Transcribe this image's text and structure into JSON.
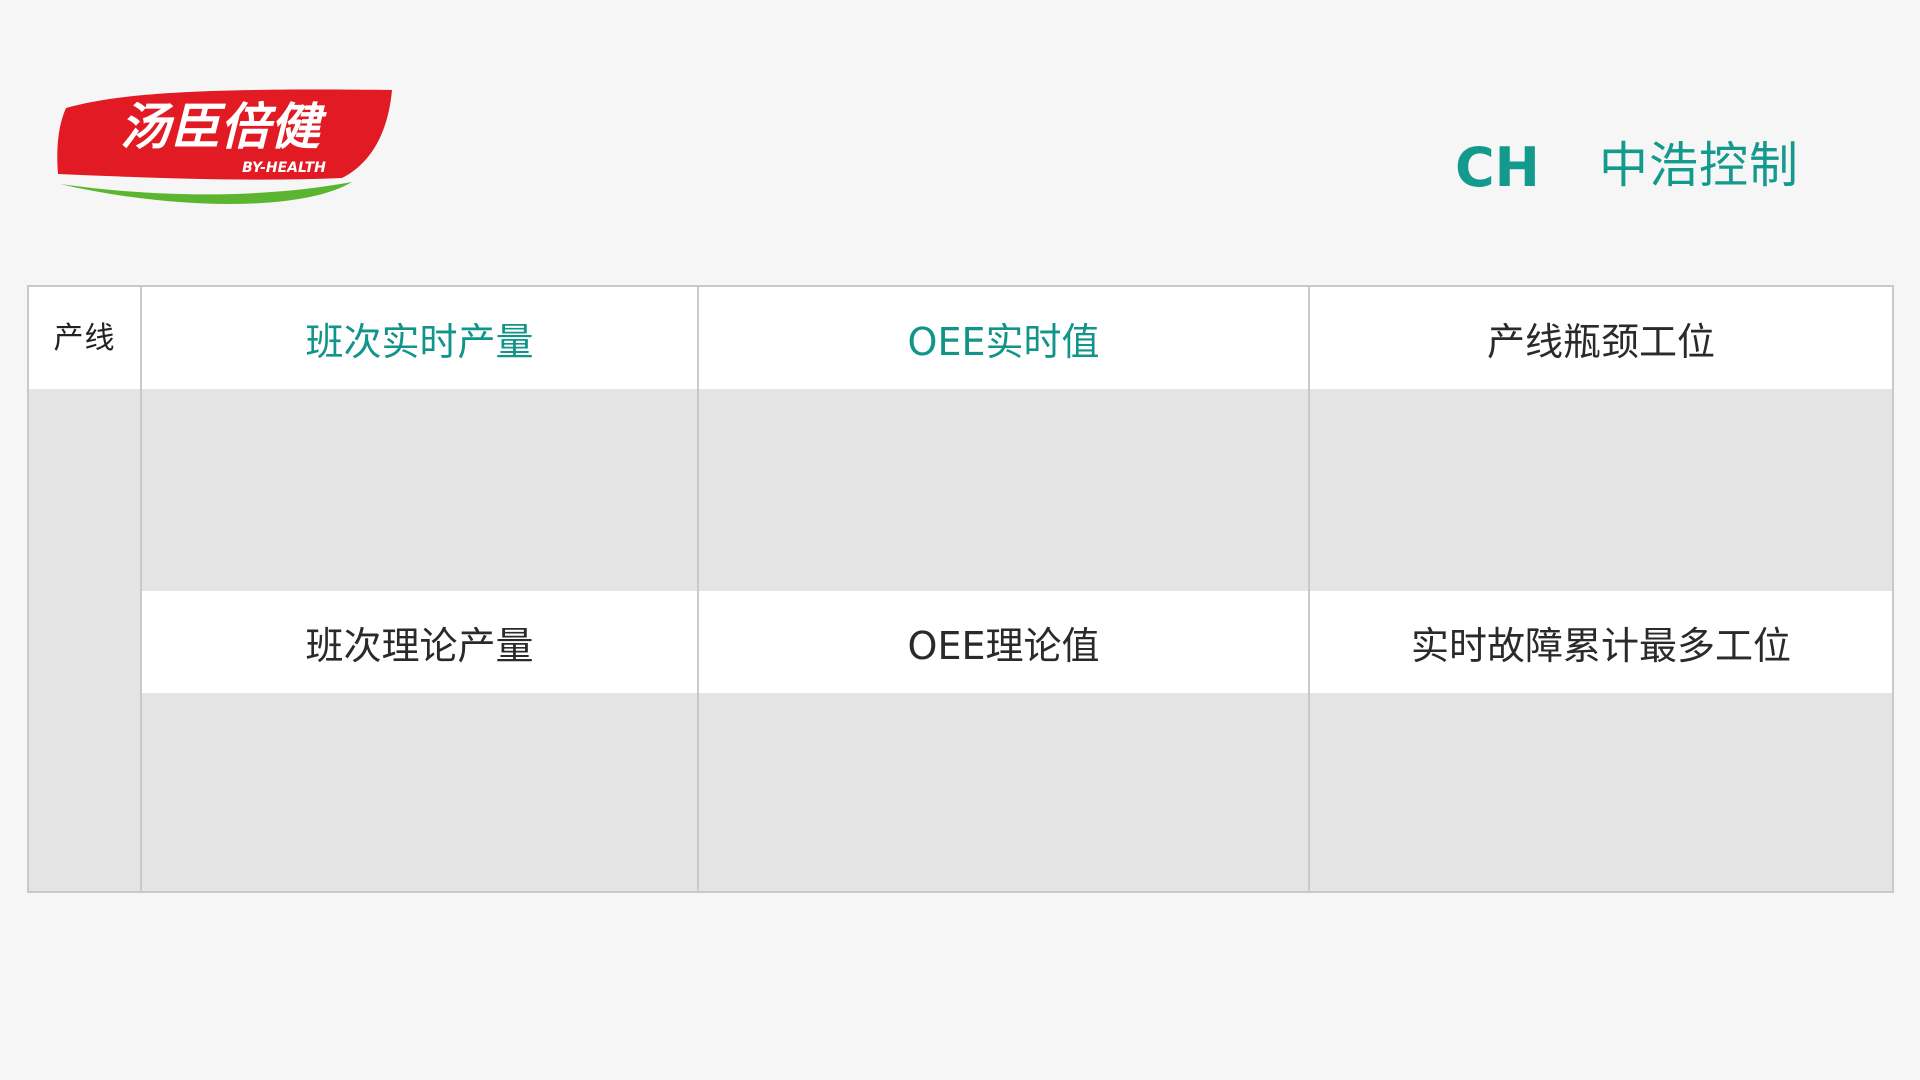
{
  "logos": {
    "left": {
      "name": "汤臣倍健",
      "subtitle": "BY-HEALTH",
      "colors": {
        "red": "#e21a24",
        "green": "#5cb531",
        "white": "#ffffff"
      }
    },
    "right": {
      "mark": "CH",
      "name": "中浩控制",
      "color": "#139a8d"
    }
  },
  "dashboard": {
    "line_label": "产线",
    "columns": [
      {
        "header": "班次实时产量",
        "header_color": "teal",
        "sub_header": "班次理论产量"
      },
      {
        "header": "OEE实时值",
        "header_color": "teal",
        "sub_header": "OEE理论值"
      },
      {
        "header": "产线瓶颈工位",
        "header_color": "dark",
        "sub_header": "实时故障累计最多工位"
      }
    ],
    "colors": {
      "background": "#f6f6f6",
      "header_bg": "#ffffff",
      "value_bg": "#e4e4e4",
      "border": "#c9c9c9",
      "teal_text": "#119489",
      "dark_text": "#2a2a2a"
    }
  }
}
